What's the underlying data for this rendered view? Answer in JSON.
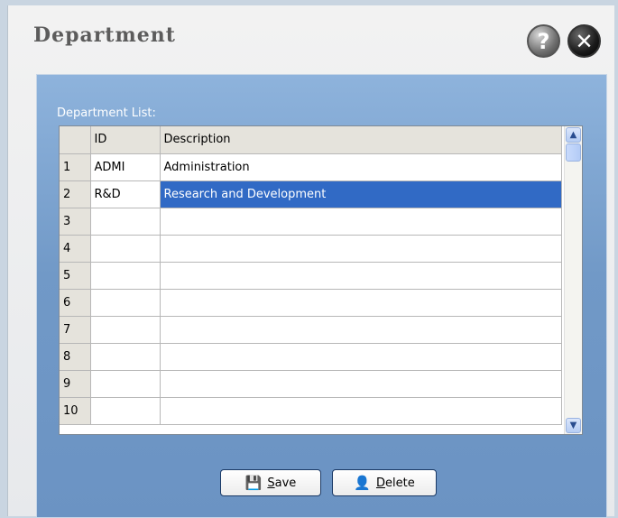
{
  "window": {
    "title": "Department"
  },
  "icons": {
    "help": "?",
    "close": "✕"
  },
  "panel": {
    "list_label": "Department List:"
  },
  "grid": {
    "columns": [
      "ID",
      "Description"
    ],
    "rows": [
      {
        "num": "1",
        "id": "ADMI",
        "description": "Administration"
      },
      {
        "num": "2",
        "id": "R&D",
        "description": "Research and Development"
      },
      {
        "num": "3",
        "id": "",
        "description": ""
      },
      {
        "num": "4",
        "id": "",
        "description": ""
      },
      {
        "num": "5",
        "id": "",
        "description": ""
      },
      {
        "num": "6",
        "id": "",
        "description": ""
      },
      {
        "num": "7",
        "id": "",
        "description": ""
      },
      {
        "num": "8",
        "id": "",
        "description": ""
      },
      {
        "num": "9",
        "id": "",
        "description": ""
      },
      {
        "num": "10",
        "id": "",
        "description": ""
      }
    ],
    "selected_row": 2
  },
  "buttons": {
    "save_label": "Save",
    "delete_label": "Delete"
  },
  "colors": {
    "selection": "#316ac5",
    "panel": "#7199c7"
  }
}
